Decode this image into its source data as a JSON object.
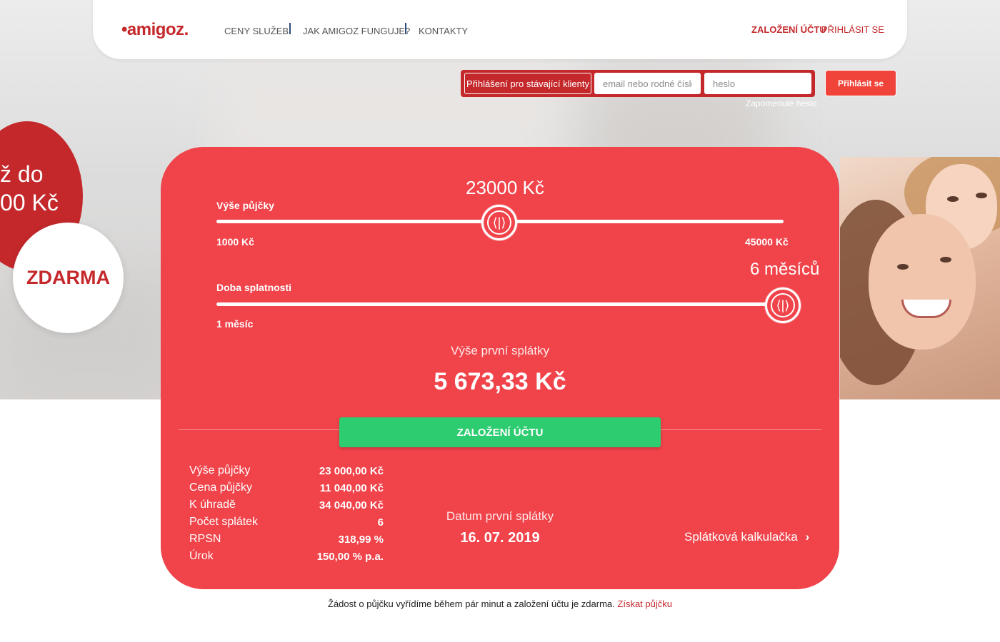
{
  "brand": {
    "logo": "•amigoz.",
    "accent": "#c4282b",
    "card_color": "#f0434a",
    "cta_color": "#2ecc71"
  },
  "nav": {
    "items": [
      "CENY SLUŽEB",
      "JAK AMIGOZ FUNGUJE?",
      "KONTAKTY"
    ],
    "register": "ZALOŽENÍ ÚČTU",
    "login": "PŘIHLÁSIT SE"
  },
  "login": {
    "label": "Přihlášení pro stávající klienty",
    "email_placeholder": "email nebo rodné číslo",
    "password_placeholder": "heslo",
    "submit": "Přihlásit se",
    "forgot": "Zapomenuté heslo"
  },
  "promo": {
    "line1": "ž do",
    "line2": "00 Kč",
    "badge": "ZDARMA"
  },
  "calculator": {
    "amount": {
      "label": "Výše půjčky",
      "value": "23000 Kč",
      "min": "1000 Kč",
      "max": "45000 Kč",
      "position": 0.5
    },
    "term": {
      "label": "Doba splatnosti",
      "value": "6 měsíců",
      "min": "1 měsíc",
      "position": 1.0
    },
    "first_payment_label": "Výše první splátky",
    "first_payment_value": "5 673,33 Kč",
    "cta": "ZALOŽENÍ ÚČTU",
    "summary": [
      {
        "label": "Výše půjčky",
        "value": "23 000,00 Kč"
      },
      {
        "label": "Cena půjčky",
        "value": "11 040,00 Kč"
      },
      {
        "label": "K úhradě",
        "value": "34 040,00 Kč"
      },
      {
        "label": "Počet splátek",
        "value": "6"
      },
      {
        "label": "RPSN",
        "value": "318,99 %"
      },
      {
        "label": "Úrok",
        "value": "150,00 % p.a."
      }
    ],
    "first_date_label": "Datum první splátky",
    "first_date_value": "16. 07. 2019",
    "calc_link": "Splátková kalkulačka",
    "calc_link_icon": "chevron-right-icon"
  },
  "footer": {
    "text": "Žádost o půjčku vyřídíme během pár minut a založení účtu je zdarma.",
    "link": "Získat půjčku"
  }
}
